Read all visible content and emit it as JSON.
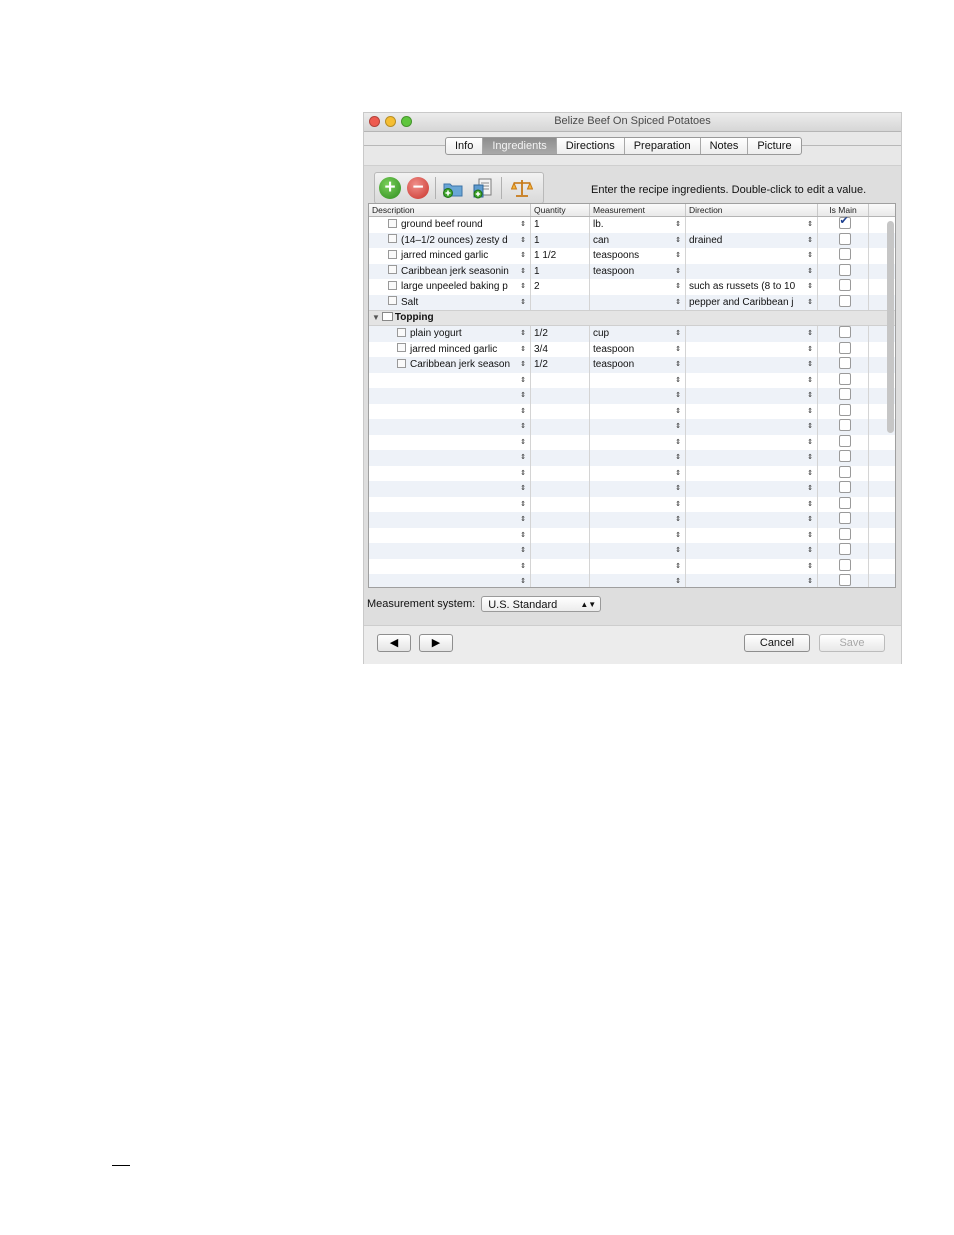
{
  "window": {
    "title": "Belize Beef On Spiced Potatoes",
    "tabs": [
      "Info",
      "Ingredients",
      "Directions",
      "Preparation",
      "Notes",
      "Picture"
    ],
    "active_tab": "Ingredients"
  },
  "toolbar": {
    "instruction": "Enter the recipe ingredients. Double-click to edit a value."
  },
  "table": {
    "headers": {
      "description": "Description",
      "quantity": "Quantity",
      "measurement": "Measurement",
      "direction": "Direction",
      "is_main": "Is Main"
    },
    "rows": [
      {
        "description": "ground beef round",
        "quantity": "1",
        "measurement": "lb.",
        "direction": "",
        "is_main": true
      },
      {
        "description": "(14–1/2 ounces) zesty d",
        "quantity": "1",
        "measurement": "can",
        "direction": "drained",
        "is_main": false
      },
      {
        "description": "jarred minced garlic",
        "quantity": "1 1/2",
        "measurement": "teaspoons",
        "direction": "",
        "is_main": false
      },
      {
        "description": "Caribbean jerk seasonin",
        "quantity": "1",
        "measurement": "teaspoon",
        "direction": "",
        "is_main": false
      },
      {
        "description": "large unpeeled baking p",
        "quantity": "2",
        "measurement": "",
        "direction": "such as russets (8 to 10",
        "is_main": false
      },
      {
        "description": "Salt",
        "quantity": "",
        "measurement": "",
        "direction": "pepper and Caribbean j",
        "is_main": false
      }
    ],
    "group": {
      "label": "Topping",
      "rows": [
        {
          "description": "plain yogurt",
          "quantity": "1/2",
          "measurement": "cup",
          "direction": "",
          "is_main": false
        },
        {
          "description": "jarred minced garlic",
          "quantity": "3/4",
          "measurement": "teaspoon",
          "direction": "",
          "is_main": false
        },
        {
          "description": "Caribbean jerk season",
          "quantity": "1/2",
          "measurement": "teaspoon",
          "direction": "",
          "is_main": false
        }
      ]
    }
  },
  "measurement_system": {
    "label": "Measurement system:",
    "value": "U.S. Standard"
  },
  "buttons": {
    "prev": "◀",
    "next": "▶",
    "cancel": "Cancel",
    "save": "Save"
  },
  "colors": {
    "add": "#2e8b1e",
    "remove": "#c9332b",
    "active_tab": "#9a9a9a"
  }
}
